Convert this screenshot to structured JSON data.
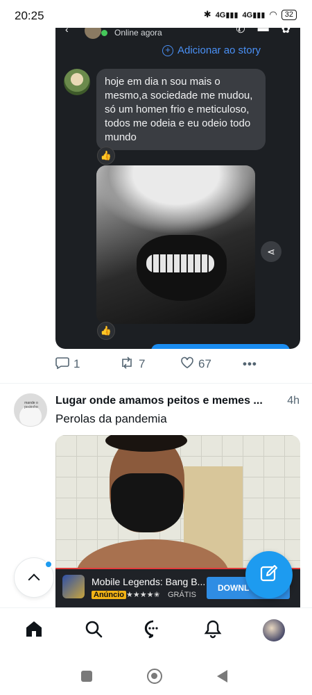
{
  "status_bar": {
    "time": "20:25",
    "signal1": "4G",
    "signal2": "4G",
    "battery": "32"
  },
  "chat": {
    "online_status": "Online agora",
    "add_story": "Adicionar ao story",
    "message": "hoje em dia n sou mais o mesmo,a sociedade me mudou, só um homen frio e meticuloso, todos me odeia e eu odeio todo mundo",
    "reaction_icon": "thumbs-up-icon"
  },
  "post_actions": {
    "replies": "1",
    "reposts": "7",
    "likes": "67"
  },
  "post2": {
    "author": "Lugar onde amamos peitos e memes ...",
    "time": "4h",
    "text": "Perolas da pandemia",
    "avatar_caption": "mande o pedrinho"
  },
  "ad": {
    "title": "Mobile Legends: Bang B...",
    "badge": "Anúncio",
    "stars": "★★★★✬",
    "price": "GRÁTIS",
    "cta": "DOWNL"
  },
  "colors": {
    "accent": "#1d9bf0",
    "chat_bg": "#1c1f23",
    "bubble": "#3a3d42",
    "muted": "#536471"
  }
}
